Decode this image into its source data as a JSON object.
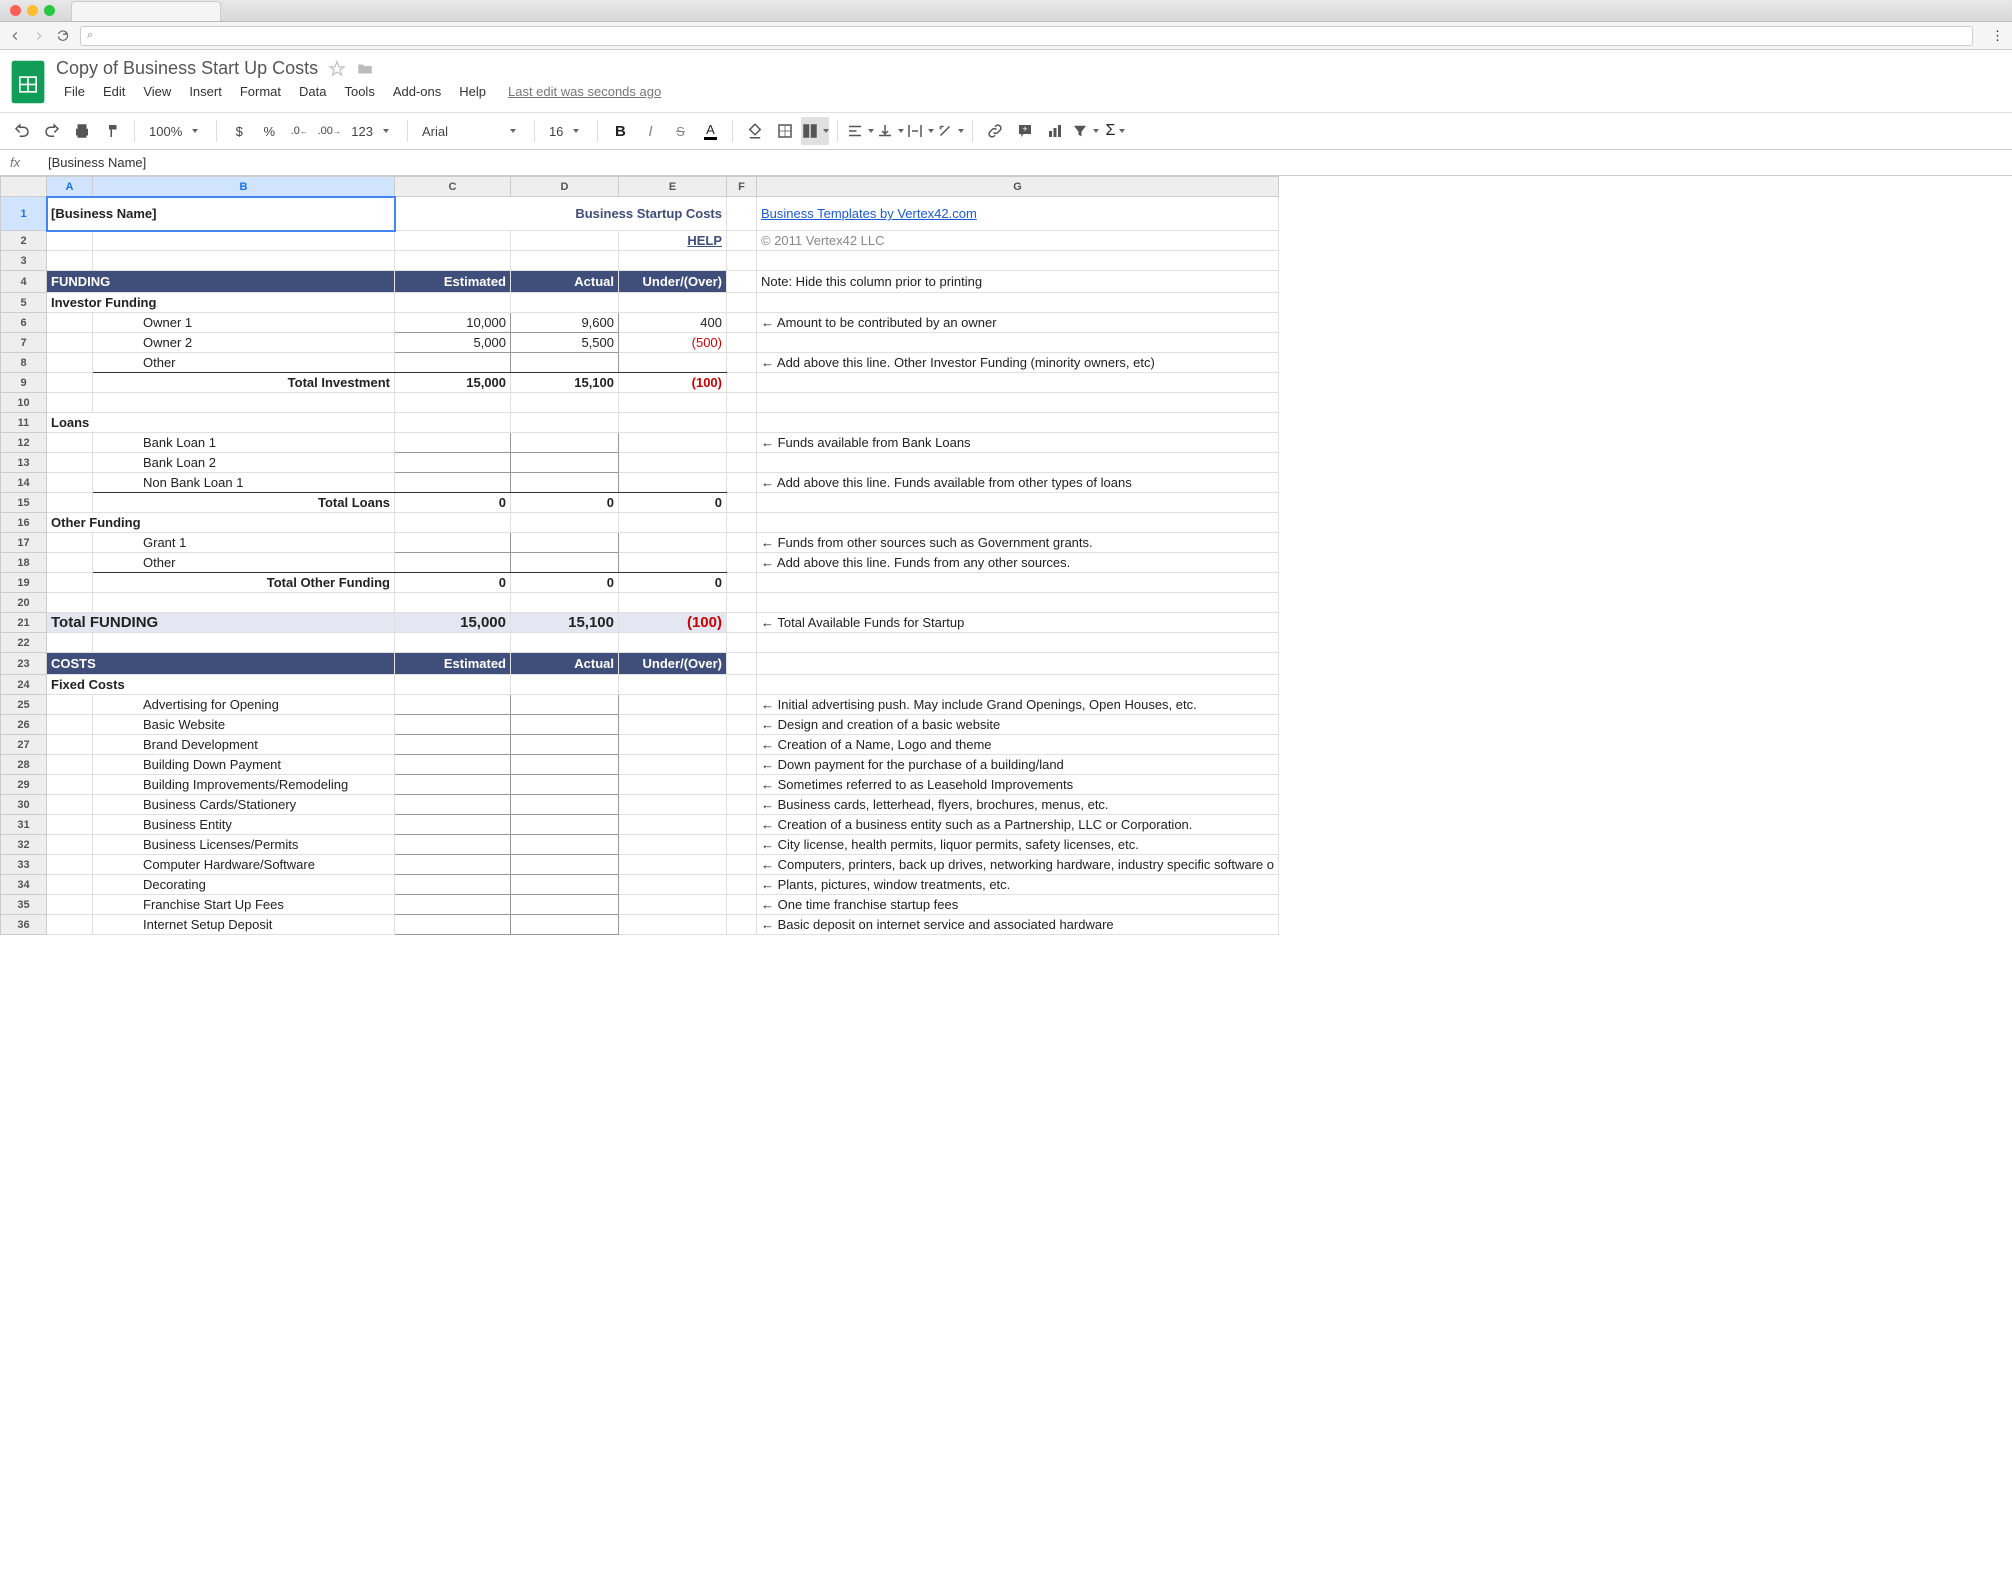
{
  "browser": {
    "url_placeholder": "⌕"
  },
  "doc": {
    "title": "Copy of Business Start Up Costs",
    "last_edit": "Last edit was seconds ago"
  },
  "menu": [
    "File",
    "Edit",
    "View",
    "Insert",
    "Format",
    "Data",
    "Tools",
    "Add-ons",
    "Help"
  ],
  "toolbar": {
    "zoom": "100%",
    "currency": "$",
    "percent": "%",
    "dec_dec": ".0",
    "inc_dec": ".00",
    "more_formats": "123",
    "font": "Arial",
    "font_size": "16"
  },
  "formula": {
    "fx": "fx",
    "value": "[Business Name]"
  },
  "columns": [
    "A",
    "B",
    "C",
    "D",
    "E",
    "F",
    "G"
  ],
  "rows": [
    "1",
    "2",
    "3",
    "4",
    "5",
    "6",
    "7",
    "8",
    "9",
    "10",
    "11",
    "12",
    "13",
    "14",
    "15",
    "16",
    "17",
    "18",
    "19",
    "20",
    "21",
    "22",
    "23",
    "24",
    "25",
    "26",
    "27",
    "28",
    "29",
    "30",
    "31",
    "32",
    "33",
    "34",
    "35",
    "36"
  ],
  "sheet": {
    "r1": {
      "title": "[Business Name]",
      "heading": "Business Startup Costs",
      "link": "Business Templates by Vertex42.com"
    },
    "r2": {
      "help": "HELP",
      "copyright": "© 2011 Vertex42 LLC"
    },
    "r4": {
      "a": "FUNDING",
      "c": "Estimated",
      "d": "Actual",
      "e": "Under/(Over)",
      "g": "Note: Hide this column prior to printing"
    },
    "r5": {
      "a": "Investor Funding"
    },
    "r6": {
      "b": "Owner 1",
      "c": "10,000",
      "d": "9,600",
      "e": "400",
      "g": "← Amount to be contributed by an owner"
    },
    "r7": {
      "b": "Owner 2",
      "c": "5,000",
      "d": "5,500",
      "e": "(500)"
    },
    "r8": {
      "b": "Other",
      "g": "← Add above this line. Other Investor Funding (minority owners, etc)"
    },
    "r9": {
      "b": "Total Investment",
      "c": "15,000",
      "d": "15,100",
      "e": "(100)"
    },
    "r11": {
      "a": "Loans"
    },
    "r12": {
      "b": "Bank Loan 1",
      "g": "← Funds available from Bank Loans"
    },
    "r13": {
      "b": "Bank Loan 2"
    },
    "r14": {
      "b": "Non Bank Loan 1",
      "g": "← Add above this line. Funds available from other types of loans"
    },
    "r15": {
      "b": "Total Loans",
      "c": "0",
      "d": "0",
      "e": "0"
    },
    "r16": {
      "a": "Other Funding"
    },
    "r17": {
      "b": "Grant 1",
      "g": "← Funds from other sources such as Government grants."
    },
    "r18": {
      "b": "Other",
      "g": "← Add above this line. Funds from any other sources."
    },
    "r19": {
      "b": "Total Other Funding",
      "c": "0",
      "d": "0",
      "e": "0"
    },
    "r21": {
      "a": "Total FUNDING",
      "c": "15,000",
      "d": "15,100",
      "e": "(100)",
      "g": "← Total Available Funds for Startup"
    },
    "r23": {
      "a": "COSTS",
      "c": "Estimated",
      "d": "Actual",
      "e": "Under/(Over)"
    },
    "r24": {
      "a": "Fixed Costs"
    },
    "r25": {
      "b": "Advertising for Opening",
      "g": "← Initial advertising push.  May include Grand Openings, Open Houses, etc."
    },
    "r26": {
      "b": "Basic Website",
      "g": "← Design and creation of a basic website"
    },
    "r27": {
      "b": "Brand Development",
      "g": "← Creation of a Name, Logo and theme"
    },
    "r28": {
      "b": "Building Down Payment",
      "g": "← Down payment for the purchase of a building/land"
    },
    "r29": {
      "b": "Building Improvements/Remodeling",
      "g": "← Sometimes referred to as Leasehold Improvements"
    },
    "r30": {
      "b": "Business Cards/Stationery",
      "g": "← Business cards, letterhead, flyers, brochures, menus, etc."
    },
    "r31": {
      "b": "Business Entity",
      "g": "← Creation of a business entity such as a Partnership, LLC or Corporation."
    },
    "r32": {
      "b": "Business Licenses/Permits",
      "g": "← City license, health permits, liquor permits, safety licenses, etc."
    },
    "r33": {
      "b": "Computer Hardware/Software",
      "g": "← Computers, printers, back up drives, networking hardware, industry specific software o"
    },
    "r34": {
      "b": "Decorating",
      "g": "← Plants, pictures, window treatments, etc."
    },
    "r35": {
      "b": "Franchise Start Up Fees",
      "g": "← One time franchise startup fees"
    },
    "r36": {
      "b": "Internet Setup Deposit",
      "g": "← Basic deposit on internet service and associated hardware"
    }
  }
}
